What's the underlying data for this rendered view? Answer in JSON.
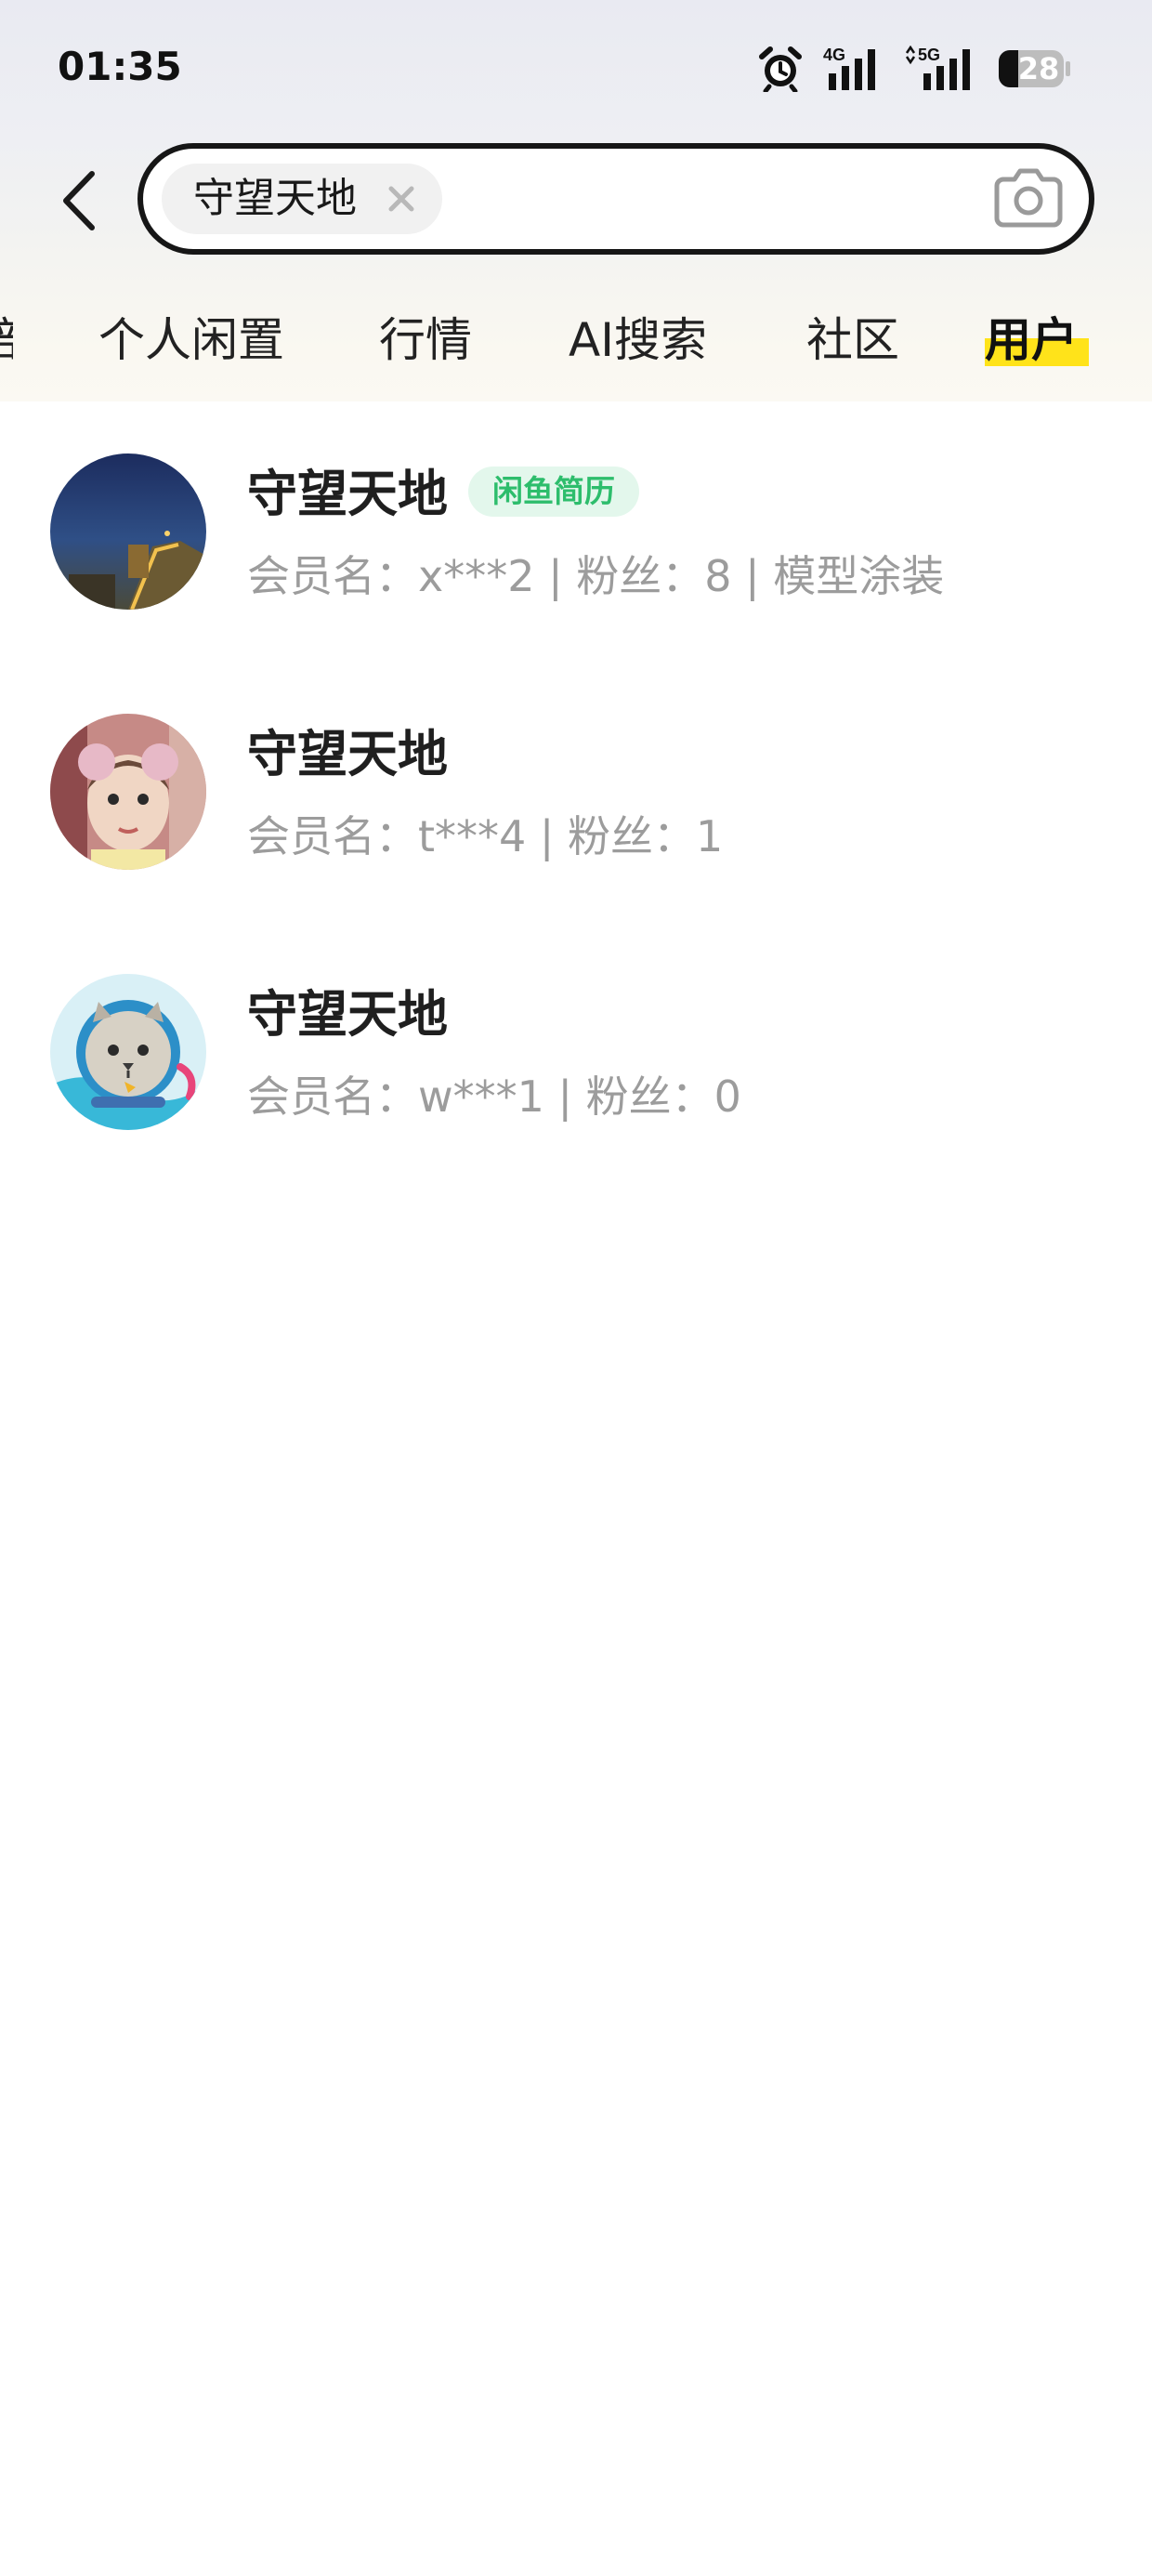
{
  "status_bar": {
    "time": "01:35",
    "battery": "28",
    "network_1": "4G",
    "network_2": "5G",
    "icons": [
      "alarm-icon",
      "signal-4g-icon",
      "signal-5g-icon",
      "battery-icon"
    ]
  },
  "search": {
    "query_chip": "守望天地",
    "icons": [
      "back-arrow-icon",
      "close-icon",
      "camera-icon"
    ]
  },
  "tabs": [
    {
      "label": "部",
      "active": false
    },
    {
      "label": "个人闲置",
      "active": false
    },
    {
      "label": "行情",
      "active": false
    },
    {
      "label": "AI搜索",
      "active": false
    },
    {
      "label": "社区",
      "active": false
    },
    {
      "label": "用户",
      "active": true
    }
  ],
  "colors": {
    "accent": "#ffe31a",
    "badge_text": "#2dbd6c",
    "badge_bg": "#e3f7ec",
    "meta_text": "#9c9c9c"
  },
  "users": [
    {
      "name": "守望天地",
      "badge": "闲鱼简历",
      "meta": "会员名：x***2 | 粉丝：8 | 模型涂装"
    },
    {
      "name": "守望天地",
      "meta": "会员名：t***4 | 粉丝：1"
    },
    {
      "name": "守望天地",
      "meta": "会员名：w***1 | 粉丝：0"
    }
  ]
}
